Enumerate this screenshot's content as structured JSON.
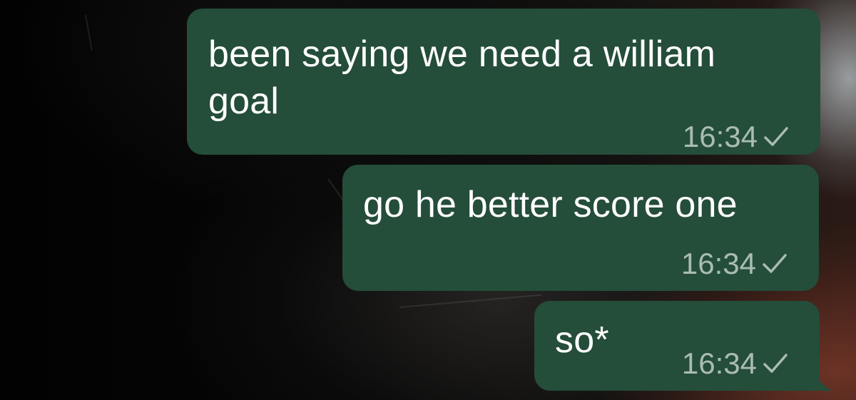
{
  "chat": {
    "messages": [
      {
        "text": "been saying we need a william\ngoal",
        "time": "16:34",
        "status_icon": "sent-checkmark-icon"
      },
      {
        "text": "go he better score one",
        "time": "16:34",
        "status_icon": "sent-checkmark-icon"
      },
      {
        "text": "so*",
        "time": "16:34",
        "status_icon": "sent-checkmark-icon"
      }
    ]
  },
  "colors": {
    "outgoing_bubble": "#244d3a",
    "message_text": "#ffffff",
    "meta_text": "#c8d6ce"
  }
}
